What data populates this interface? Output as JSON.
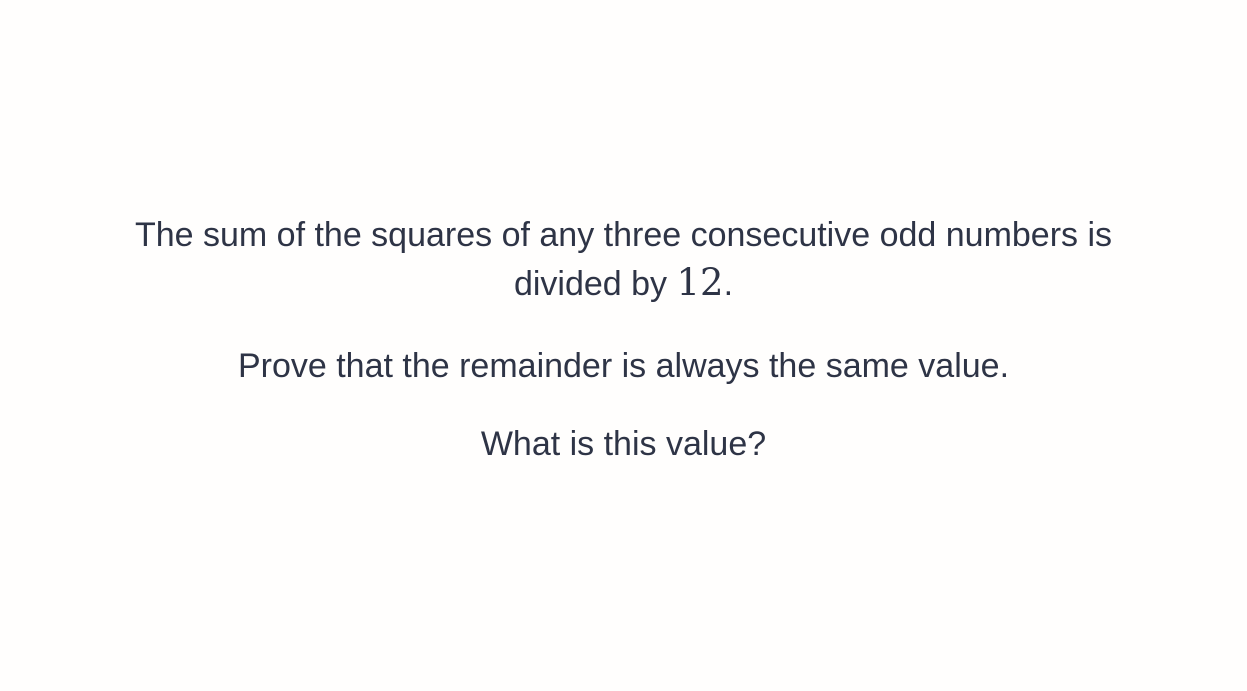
{
  "question": {
    "line1": "The sum of the squares of any three consecutive odd numbers is",
    "line2_prefix": "divided by ",
    "line2_math": "12",
    "line2_suffix": ".",
    "prompt": "Prove that the remainder is always the same value.",
    "ask": "What is this value?"
  },
  "colors": {
    "text": "#2e3446",
    "background": "#fffefd"
  }
}
